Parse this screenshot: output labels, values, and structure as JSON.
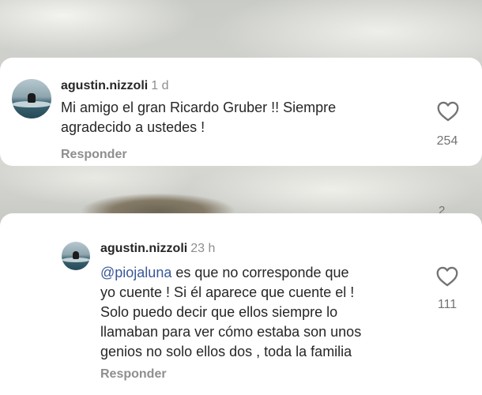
{
  "comments": [
    {
      "username": "agustin.nizzoli",
      "time": "1 d",
      "mention": "",
      "text_lines": [
        "Mi amigo el gran Ricardo Gruber !! Siempre",
        "agradecido a ustedes !"
      ],
      "reply_label": "Responder",
      "likes": "254"
    },
    {
      "username": "agustin.nizzoli",
      "time": "23 h",
      "mention": "@piojaluna",
      "text_lines": [
        " es que no corresponde que",
        "yo cuente ! Si él aparece que cuente el !",
        "Solo puedo decir que ellos siempre lo",
        "llamaban para ver cómo estaba son unos",
        "genios no solo ellos dos , toda la familia"
      ],
      "reply_label": "Responder",
      "likes": "111"
    }
  ],
  "partial_like_count": "2",
  "icons": {
    "like": "heart-outline-icon"
  }
}
